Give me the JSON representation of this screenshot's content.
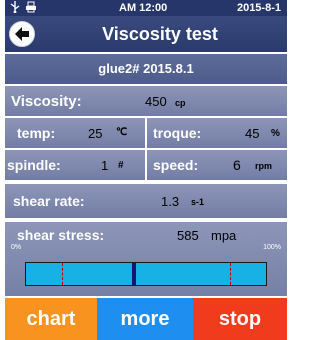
{
  "status": {
    "time": "AM 12:00",
    "date": "2015-8-1",
    "icons": [
      "usb-icon",
      "printer-icon"
    ]
  },
  "header": {
    "title": "Viscosity test",
    "back_icon": "back-arrow-icon"
  },
  "sample_name": "glue2# 2015.8.1",
  "readings": {
    "viscosity": {
      "label": "Viscosity:",
      "value": "450",
      "unit": "cp"
    },
    "temp": {
      "label": "temp:",
      "value": "25",
      "unit": "℃"
    },
    "torque": {
      "label": "troque:",
      "value": "45",
      "unit": "%"
    },
    "spindle": {
      "label": "spindle:",
      "value": "1",
      "unit": "#"
    },
    "speed": {
      "label": "speed:",
      "value": "6",
      "unit": "rpm"
    },
    "shear_rate": {
      "label": "shear rate:",
      "value": "1.3",
      "unit": "s-1"
    },
    "shear_stress": {
      "label": "shear stress:",
      "value": "585",
      "unit": "mpa"
    }
  },
  "gauge": {
    "min_label": "0%",
    "max_label": "100%",
    "value_percent": 45,
    "limit_low_percent": 15,
    "limit_high_percent": 85,
    "fill_color": "#17b1e6",
    "needle_color": "#15166e",
    "limit_color": "#c00000"
  },
  "buttons": {
    "chart": "chart",
    "more": "more",
    "stop": "stop"
  },
  "colors": {
    "statusbar": "#26356a",
    "chart": "#f7931e",
    "more": "#1e8ff0",
    "stop": "#f03c1c"
  }
}
